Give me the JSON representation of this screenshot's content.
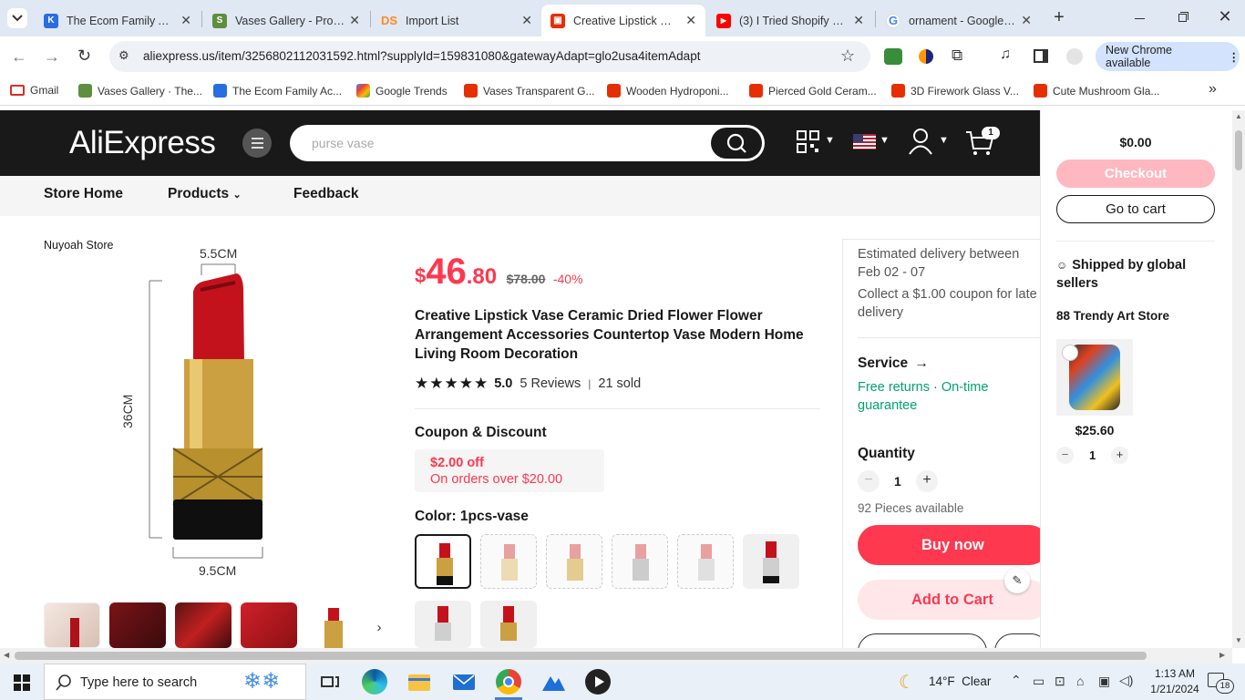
{
  "browser": {
    "tabs": [
      {
        "label": "The Ecom Family Acad",
        "icon": "ecom-family-icon",
        "color": "#2a6de0"
      },
      {
        "label": "Vases Gallery - Produc",
        "icon": "shopify-icon",
        "color": "#5e8e3e"
      },
      {
        "label": "Import List",
        "icon": "ds-icon",
        "color": "#ff8a1e"
      },
      {
        "label": "Creative Lipstick Vase",
        "icon": "aliexpress-icon",
        "color": "#e62e04"
      },
      {
        "label": "(3) I Tried Shopify Dro",
        "icon": "youtube-icon",
        "color": "#ff0000"
      },
      {
        "label": "ornament - Google Se",
        "icon": "google-icon",
        "color": "#4285f4"
      }
    ],
    "url": "aliexpress.us/item/3256802112031592.html?supplyId=159831080&gatewayAdapt=glo2usa4itemAdapt",
    "new_chrome": "New Chrome available",
    "bookmarks": [
      {
        "label": "Gmail"
      },
      {
        "label": "Vases Gallery · The..."
      },
      {
        "label": "The Ecom Family Ac..."
      },
      {
        "label": "Google Trends"
      },
      {
        "label": "Vases Transparent G..."
      },
      {
        "label": "Wooden Hydroponi..."
      },
      {
        "label": "Pierced Gold Ceram..."
      },
      {
        "label": "3D Firework Glass V..."
      },
      {
        "label": "Cute Mushroom Gla..."
      }
    ]
  },
  "site": {
    "logo": "AliExpress",
    "search_placeholder": "purse vase",
    "cart_count": "1",
    "store_nav": {
      "home": "Store Home",
      "products": "Products",
      "feedback": "Feedback"
    },
    "store_name": "Nuyoah Store"
  },
  "product": {
    "image_dims": {
      "top": "5.5CM",
      "side": "36CM",
      "bottom": "9.5CM"
    },
    "currency": "$",
    "price_int": "46",
    "price_dec": ".80",
    "original_price": "$78.00",
    "discount": "-40%",
    "title": "Creative Lipstick Vase Ceramic Dried Flower Flower Arrangement Accessories Countertop Vase Modern Home Living Room Decoration",
    "rating": "5.0",
    "rating_stars": 5,
    "reviews": "5 Reviews",
    "sold": "21 sold",
    "coupon_heading": "Coupon & Discount",
    "coupon_value": "$2.00 off",
    "coupon_condition": "On orders over $20.00",
    "color_label": "Color: 1pcs-vase"
  },
  "purchase": {
    "delivery": "Estimated delivery between Feb 02 - 07",
    "coupon_late": "Collect a $1.00 coupon for late delivery",
    "service_heading": "Service",
    "service_free_returns": "Free returns",
    "service_sep": "·",
    "service_ontime": "On-time guarantee",
    "quantity_heading": "Quantity",
    "quantity": "1",
    "pieces_available": "92 Pieces available",
    "buy_now": "Buy now",
    "add_to_cart": "Add to Cart"
  },
  "cart_panel": {
    "total": "$0.00",
    "checkout": "Checkout",
    "go_to_cart": "Go to cart",
    "shipped_by": "Shipped by global sellers",
    "store": "88 Trendy Art Store",
    "item_price": "$25.60",
    "item_qty": "1"
  },
  "taskbar": {
    "search_placeholder": "Type here to search",
    "weather": "14°F  Clear",
    "time": "1:13 AM",
    "date": "1/21/2024",
    "notifications": "18"
  }
}
